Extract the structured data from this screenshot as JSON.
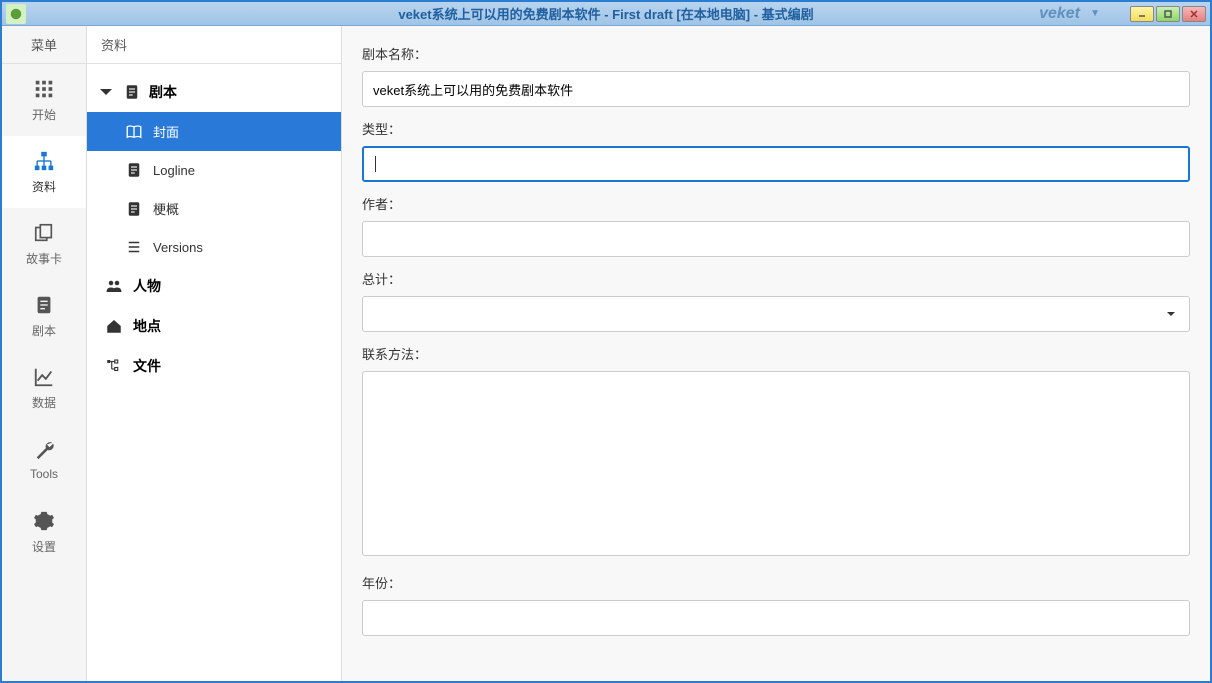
{
  "titlebar": {
    "title": "veket系统上可以用的免费剧本软件 - First draft [在本地电脑] - 基式编剧",
    "brand": "veket"
  },
  "sidebar": {
    "menu_header": "菜单",
    "items": [
      {
        "label": "开始"
      },
      {
        "label": "资料"
      },
      {
        "label": "故事卡"
      },
      {
        "label": "剧本"
      },
      {
        "label": "数据"
      },
      {
        "label": "Tools"
      },
      {
        "label": "设置"
      }
    ]
  },
  "midpanel": {
    "header": "资料",
    "root": "剧本",
    "items": [
      {
        "label": "封面"
      },
      {
        "label": "Logline"
      },
      {
        "label": "梗概"
      },
      {
        "label": "Versions"
      }
    ],
    "sections": [
      {
        "label": "人物"
      },
      {
        "label": "地点"
      },
      {
        "label": "文件"
      }
    ]
  },
  "form": {
    "name_label": "剧本名称：",
    "name_value": "veket系统上可以用的免费剧本软件",
    "type_label": "类型：",
    "type_value": "",
    "author_label": "作者：",
    "author_value": "",
    "total_label": "总计：",
    "total_value": "",
    "contact_label": "联系方法：",
    "contact_value": "",
    "year_label": "年份：",
    "year_value": ""
  }
}
